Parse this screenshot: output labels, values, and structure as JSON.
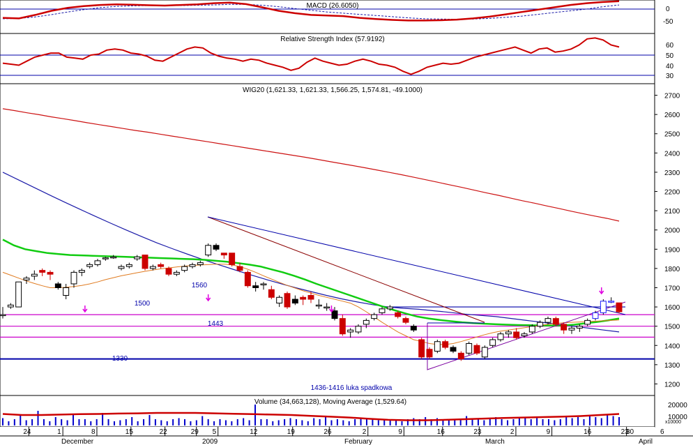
{
  "chart_data": {
    "type": "candlestick",
    "panels": {
      "macd": {
        "title": "MACD (26.6050)",
        "y_ticks": [
          "0",
          "-50"
        ],
        "macd": [
          -30,
          -32,
          -20,
          -6,
          4,
          10,
          14,
          16,
          15,
          13,
          12,
          14,
          16,
          20,
          22,
          17,
          6,
          -6,
          -14,
          -20,
          -22,
          -24,
          -30,
          -34,
          -37,
          -39,
          -39,
          -38,
          -36,
          -32,
          -26,
          -18,
          -10,
          -2,
          6,
          14,
          20,
          24,
          27
        ],
        "signal": [
          -33,
          -32,
          -27,
          -19,
          -10,
          -2,
          5,
          9,
          11,
          12,
          12,
          12,
          13,
          14,
          16,
          16,
          13,
          8,
          2,
          -4,
          -10,
          -14,
          -18,
          -22,
          -26,
          -30,
          -33,
          -34,
          -35,
          -34,
          -32,
          -28,
          -24,
          -18,
          -12,
          -6,
          0,
          8,
          14
        ]
      },
      "rsi": {
        "title": "Relative Strength Index (57.9192)",
        "y_ticks": [
          "60",
          "50",
          "40",
          "30"
        ],
        "levels": [
          50,
          30
        ],
        "values": [
          42,
          41,
          40,
          44,
          48,
          50,
          52,
          52,
          48,
          47,
          46,
          50,
          51,
          55,
          56,
          55,
          52,
          51,
          49,
          45,
          44,
          48,
          52,
          56,
          58,
          57,
          52,
          49,
          47,
          46,
          44,
          46,
          45,
          42,
          40,
          38,
          35,
          37,
          43,
          47,
          44,
          42,
          40,
          41,
          44,
          46,
          44,
          41,
          40,
          38,
          34,
          31,
          34,
          38,
          40,
          42,
          41,
          42,
          45,
          48,
          50,
          52,
          54,
          56,
          58,
          55,
          52,
          56,
          57,
          53,
          54,
          56,
          60,
          66,
          67,
          65,
          60,
          58
        ]
      },
      "price": {
        "title": "WIG20 (1,621.33, 1,621.33, 1,566.25, 1,574.81, -49.1000)",
        "y_ticks": [
          2700,
          2600,
          2500,
          2400,
          2300,
          2200,
          2100,
          2000,
          1900,
          1800,
          1700,
          1600,
          1500,
          1400,
          1300,
          1200
        ],
        "ylim": [
          1140,
          2760
        ],
        "candles": [
          [
            1560,
            1600,
            1540,
            1560
          ],
          [
            1600,
            1620,
            1590,
            1610
          ],
          [
            1600,
            1730,
            1600,
            1730
          ],
          [
            1740,
            1760,
            1720,
            1750
          ],
          [
            1760,
            1790,
            1740,
            1770
          ],
          [
            1790,
            1800,
            1760,
            1780
          ],
          [
            1780,
            1790,
            1740,
            1770
          ],
          [
            1720,
            1730,
            1690,
            1700
          ],
          [
            1660,
            1720,
            1640,
            1700
          ],
          [
            1720,
            1790,
            1700,
            1780
          ],
          [
            1780,
            1800,
            1760,
            1790
          ],
          [
            1810,
            1830,
            1800,
            1820
          ],
          [
            1820,
            1850,
            1810,
            1840
          ],
          [
            1850,
            1860,
            1840,
            1855
          ],
          [
            1860,
            1870,
            1850,
            1860
          ],
          [
            1800,
            1820,
            1790,
            1810
          ],
          [
            1810,
            1830,
            1800,
            1820
          ],
          [
            1850,
            1870,
            1840,
            1860
          ],
          [
            1870,
            1870,
            1790,
            1800
          ],
          [
            1800,
            1820,
            1790,
            1810
          ],
          [
            1820,
            1830,
            1800,
            1810
          ],
          [
            1800,
            1810,
            1760,
            1770
          ],
          [
            1770,
            1790,
            1760,
            1780
          ],
          [
            1790,
            1820,
            1780,
            1810
          ],
          [
            1810,
            1830,
            1800,
            1820
          ],
          [
            1820,
            1840,
            1810,
            1830
          ],
          [
            1870,
            1930,
            1860,
            1920
          ],
          [
            1920,
            1930,
            1890,
            1900
          ],
          [
            1880,
            1880,
            1850,
            1870
          ],
          [
            1880,
            1880,
            1810,
            1820
          ],
          [
            1810,
            1830,
            1780,
            1790
          ],
          [
            1780,
            1790,
            1700,
            1710
          ],
          [
            1710,
            1730,
            1680,
            1700
          ],
          [
            1720,
            1730,
            1690,
            1720
          ],
          [
            1690,
            1710,
            1640,
            1650
          ],
          [
            1620,
            1660,
            1600,
            1650
          ],
          [
            1670,
            1680,
            1590,
            1600
          ],
          [
            1640,
            1660,
            1610,
            1620
          ],
          [
            1650,
            1660,
            1610,
            1640
          ],
          [
            1660,
            1680,
            1620,
            1640
          ],
          [
            1610,
            1640,
            1590,
            1610
          ],
          [
            1600,
            1620,
            1580,
            1600
          ],
          [
            1580,
            1600,
            1530,
            1540
          ],
          [
            1540,
            1560,
            1450,
            1460
          ],
          [
            1470,
            1490,
            1440,
            1480
          ],
          [
            1470,
            1510,
            1460,
            1500
          ],
          [
            1510,
            1540,
            1490,
            1530
          ],
          [
            1540,
            1570,
            1530,
            1560
          ],
          [
            1570,
            1600,
            1560,
            1590
          ],
          [
            1590,
            1610,
            1580,
            1600
          ],
          [
            1570,
            1580,
            1540,
            1550
          ],
          [
            1540,
            1550,
            1510,
            1520
          ],
          [
            1500,
            1510,
            1470,
            1480
          ],
          [
            1430,
            1440,
            1330,
            1340
          ],
          [
            1380,
            1390,
            1330,
            1340
          ],
          [
            1370,
            1430,
            1360,
            1420
          ],
          [
            1420,
            1430,
            1380,
            1390
          ],
          [
            1390,
            1400,
            1360,
            1370
          ],
          [
            1360,
            1370,
            1320,
            1330
          ],
          [
            1360,
            1420,
            1350,
            1410
          ],
          [
            1400,
            1410,
            1350,
            1360
          ],
          [
            1340,
            1400,
            1330,
            1390
          ],
          [
            1400,
            1440,
            1390,
            1430
          ],
          [
            1430,
            1470,
            1420,
            1460
          ],
          [
            1460,
            1480,
            1440,
            1470
          ],
          [
            1470,
            1490,
            1430,
            1440
          ],
          [
            1450,
            1470,
            1440,
            1460
          ],
          [
            1470,
            1510,
            1460,
            1500
          ],
          [
            1500,
            1530,
            1490,
            1520
          ],
          [
            1520,
            1550,
            1510,
            1540
          ],
          [
            1540,
            1550,
            1500,
            1510
          ],
          [
            1510,
            1520,
            1460,
            1480
          ],
          [
            1480,
            1500,
            1460,
            1490
          ],
          [
            1490,
            1510,
            1470,
            1500
          ],
          [
            1510,
            1540,
            1500,
            1530
          ],
          [
            1540,
            1580,
            1530,
            1570
          ],
          [
            1570,
            1640,
            1560,
            1630
          ],
          [
            1630,
            1650,
            1620,
            1630
          ],
          [
            1621.33,
            1621.33,
            1566.25,
            1574.81
          ]
        ],
        "ma_long_red": [
          2630,
          2620,
          2609,
          2599,
          2588,
          2578,
          2568,
          2557,
          2547,
          2537,
          2527,
          2517,
          2508,
          2498,
          2488,
          2478,
          2468,
          2458,
          2448,
          2438,
          2428,
          2418,
          2408,
          2398,
          2388,
          2378,
          2367,
          2356,
          2345,
          2334,
          2323,
          2311,
          2299,
          2287,
          2274,
          2261,
          2248,
          2234,
          2221,
          2207,
          2193,
          2180,
          2166,
          2152,
          2139,
          2125,
          2112,
          2098,
          2085,
          2072,
          2060,
          2046
        ],
        "ma_blue": [
          2300,
          2261,
          2222,
          2183,
          2145,
          2108,
          2071,
          2035,
          2000,
          1966,
          1933,
          1903,
          1874,
          1846,
          1820,
          1794,
          1769,
          1745,
          1722,
          1700,
          1680,
          1660,
          1642,
          1626,
          1612,
          1600,
          1593,
          1588,
          1580,
          1572,
          1563,
          1556,
          1550,
          1540,
          1530,
          1520,
          1510,
          1500,
          1490,
          1480,
          1470
        ],
        "ma_green": [
          1950,
          1920,
          1900,
          1890,
          1880,
          1875,
          1870,
          1868,
          1866,
          1864,
          1862,
          1860,
          1858,
          1856,
          1854,
          1852,
          1850,
          1848,
          1845,
          1840,
          1835,
          1828,
          1820,
          1810,
          1795,
          1780,
          1762,
          1742,
          1720,
          1700,
          1680,
          1660,
          1640,
          1620,
          1600,
          1582,
          1565,
          1550,
          1540,
          1532,
          1526,
          1520,
          1516,
          1513,
          1510,
          1508,
          1506,
          1505,
          1504,
          1503,
          1504,
          1508,
          1515,
          1522,
          1530,
          1540
        ],
        "ma_orange": [
          1780,
          1765,
          1750,
          1735,
          1722,
          1710,
          1700,
          1700,
          1702,
          1706,
          1712,
          1720,
          1730,
          1742,
          1752,
          1762,
          1770,
          1778,
          1785,
          1792,
          1798,
          1803,
          1808,
          1812,
          1816,
          1818,
          1820,
          1822,
          1822,
          1818,
          1810,
          1796,
          1780,
          1762,
          1745,
          1728,
          1712,
          1698,
          1684,
          1672,
          1660,
          1650,
          1640,
          1630,
          1620,
          1600,
          1575,
          1548,
          1520,
          1495,
          1470,
          1450,
          1430,
          1420,
          1410,
          1405,
          1405,
          1410,
          1420,
          1432,
          1444,
          1456,
          1466,
          1474,
          1480,
          1486,
          1492,
          1498,
          1504,
          1510,
          1514,
          1518,
          1520,
          1522,
          1524,
          1526,
          1528,
          1530,
          1532
        ],
        "h_lines": [
          {
            "value": 1600,
            "color": "#0000aa",
            "start_index": 49
          },
          {
            "value": 1560,
            "color": "#cc00cc",
            "label": "1560"
          },
          {
            "value": 1500,
            "color": "#cc00cc",
            "label": "1500"
          },
          {
            "value": 1443,
            "color": "#cc00cc",
            "label": "1443"
          },
          {
            "value": 1330,
            "color": "#0000aa",
            "label": "1330"
          }
        ],
        "annotation": "1436-1416 luka spadkowa",
        "arrows": [
          14,
          35,
          56,
          102
        ]
      },
      "volume": {
        "title": "Volume (34,663,128), Moving Average (1,529.64)",
        "y_ticks": [
          "20000",
          "10000"
        ],
        "unit": "x10000",
        "bars": [
          0.35,
          0.2,
          0.3,
          0.5,
          0.25,
          0.3,
          0.7,
          0.3,
          0.2,
          0.4,
          0.3,
          0.25,
          0.5,
          0.3,
          0.3,
          0.2,
          0.3,
          0.6,
          0.3,
          0.2,
          0.25,
          0.3,
          0.4,
          0.2,
          0.3,
          0.5,
          0.3,
          0.25,
          0.2,
          0.3,
          0.35,
          0.3,
          0.2,
          0.25,
          0.45,
          0.3,
          0.2,
          0.3,
          0.25,
          0.2,
          0.3,
          0.35,
          0.25,
          1.0,
          0.3,
          0.3,
          0.2,
          0.25,
          0.3,
          0.35,
          0.3,
          0.25,
          0.2,
          0.35,
          0.3,
          0.4,
          0.25,
          0.3,
          0.25,
          0.2,
          0.3,
          0.35,
          0.3,
          0.3,
          0.25,
          0.3,
          0.3,
          0.25,
          0.2,
          0.3,
          0.35,
          0.3,
          0.4,
          0.3,
          0.35,
          0.3,
          0.3,
          0.25,
          0.3,
          0.45,
          0.3,
          0.3,
          0.25,
          0.3,
          0.4,
          0.3,
          0.25,
          0.3,
          0.35,
          0.4,
          0.3,
          0.35,
          0.3,
          0.3,
          0.25,
          0.3,
          0.4,
          0.35,
          0.4,
          0.3,
          0.45,
          0.4,
          0.35,
          0.5,
          0.45,
          0.4
        ],
        "ma": [
          0.55,
          0.5,
          0.5,
          0.52,
          0.54,
          0.55,
          0.57,
          0.58,
          0.6,
          0.6,
          0.6,
          0.58,
          0.56,
          0.54,
          0.52,
          0.5,
          0.46,
          0.42,
          0.38,
          0.32,
          0.27,
          0.25,
          0.25,
          0.27,
          0.3,
          0.33,
          0.36,
          0.38,
          0.4,
          0.42,
          0.45,
          0.5,
          0.55
        ]
      }
    },
    "x_ticks": [
      {
        "label": "24",
        "pos": 0.044
      },
      {
        "label": "1",
        "pos": 0.096
      },
      {
        "label": "8",
        "pos": 0.148
      },
      {
        "label": "15",
        "pos": 0.2
      },
      {
        "label": "22",
        "pos": 0.252
      },
      {
        "label": "29",
        "pos": 0.3
      },
      {
        "label": "5",
        "pos": 0.333
      },
      {
        "label": "12",
        "pos": 0.39
      },
      {
        "label": "19",
        "pos": 0.447
      },
      {
        "label": "26",
        "pos": 0.503
      },
      {
        "label": "2",
        "pos": 0.562
      },
      {
        "label": "9",
        "pos": 0.617
      },
      {
        "label": "16",
        "pos": 0.676
      },
      {
        "label": "23",
        "pos": 0.732
      },
      {
        "label": "2",
        "pos": 0.788
      },
      {
        "label": "9",
        "pos": 0.843
      },
      {
        "label": "16",
        "pos": 0.9
      },
      {
        "label": "23",
        "pos": 0.957
      }
    ],
    "x_ticks_outside": [
      "30",
      "6"
    ],
    "month_labels": [
      "December",
      "2009",
      "February",
      "March",
      "April"
    ]
  }
}
